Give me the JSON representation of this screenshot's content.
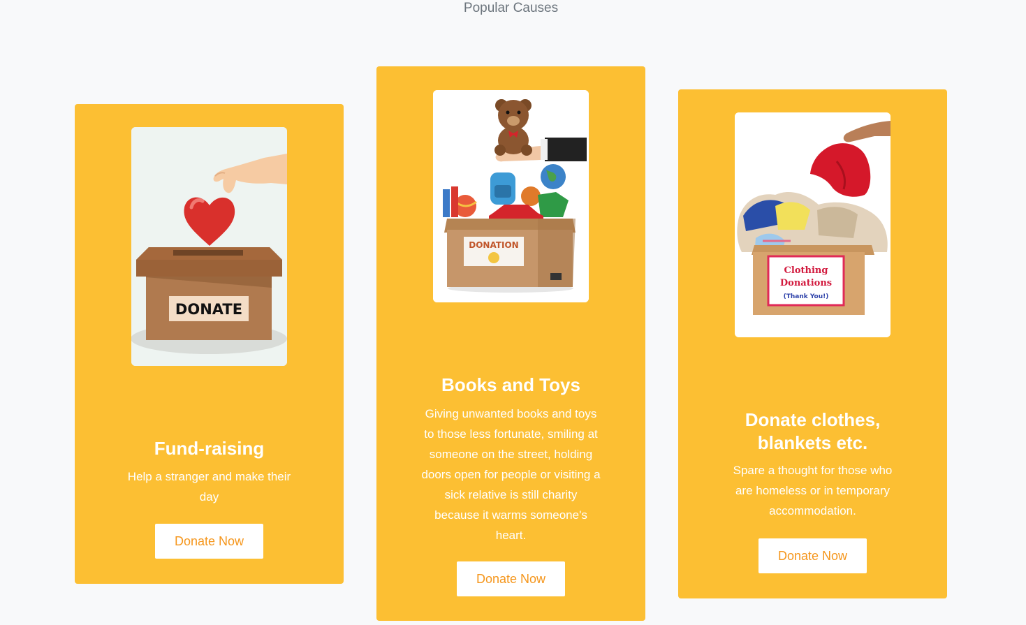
{
  "section": {
    "title": "Popular Causes"
  },
  "causes": [
    {
      "title": "Fund-raising",
      "text": "Help a stranger and make their day",
      "button": "Donate Now",
      "image_label": "DONATE"
    },
    {
      "title": "Books and Toys",
      "text": "Giving unwanted books and toys to those less fortunate, smiling at someone on the street, holding doors open for people or visiting a sick relative is still charity because it warms someone's heart.",
      "button": "Donate Now",
      "image_label": "DONATION"
    },
    {
      "title": "Donate clothes, blankets etc.",
      "text": "Spare a thought for those who are homeless or in temporary accommodation.",
      "button": "Donate Now",
      "image_label_1": "Clothing",
      "image_label_2": "Donations",
      "image_label_3": "(Thank You!)"
    }
  ],
  "colors": {
    "card_bg": "#fcbf33",
    "button_text": "#f5961c",
    "page_bg": "#f8f9fa"
  }
}
